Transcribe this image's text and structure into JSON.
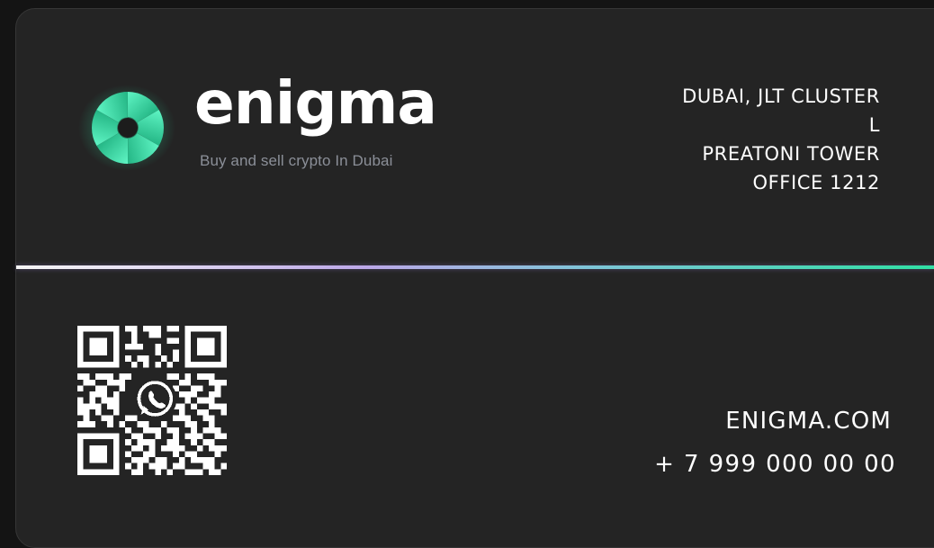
{
  "brand": {
    "name": "enigma",
    "tagline": "Buy and sell crypto In Dubai",
    "accent_color": "#2ee0a0",
    "logo_icon": "aperture-logo-icon"
  },
  "address": {
    "lines": [
      "DUBAI, JLT CLUSTER",
      "L",
      "PREATONI TOWER",
      "OFFICE 1212"
    ]
  },
  "contact": {
    "website": "ENIGMA.COM",
    "phone": "+ 7 999 000 00 00",
    "qr_icon": "whatsapp-icon"
  },
  "theme": {
    "card_background": "#242424",
    "text_color": "#ffffff",
    "tagline_color": "#8b8f98"
  }
}
